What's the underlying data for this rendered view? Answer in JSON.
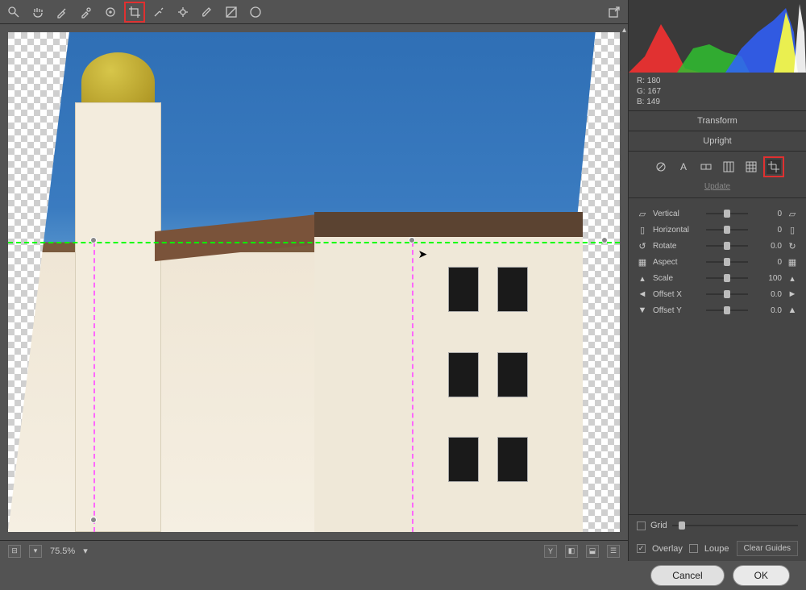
{
  "toolbar": {
    "tools": [
      "zoom",
      "hand",
      "eyedropper",
      "sampler",
      "target",
      "crop",
      "spot",
      "adjust",
      "brush",
      "gradient",
      "radial"
    ],
    "selected_index": 5
  },
  "canvas": {
    "zoom_label": "75.5%"
  },
  "rgb": {
    "R_label": "R:",
    "R": "180",
    "G_label": "G:",
    "G": "167",
    "B_label": "B:",
    "B": "149"
  },
  "panel": {
    "transform_title": "Transform",
    "upright_title": "Upright",
    "upright_modes": [
      "off",
      "auto",
      "level",
      "vertical",
      "full",
      "guided"
    ],
    "upright_selected": 5,
    "update_label": "Update"
  },
  "sliders": {
    "items": [
      {
        "label": "Vertical",
        "value": "0",
        "icon_left": "v-top",
        "icon_right": "v-bottom"
      },
      {
        "label": "Horizontal",
        "value": "0",
        "icon_left": "h-left",
        "icon_right": "h-right"
      },
      {
        "label": "Rotate",
        "value": "0.0",
        "icon_left": "rot-ccw",
        "icon_right": "rot-cw"
      },
      {
        "label": "Aspect",
        "value": "0",
        "icon_left": "grid9",
        "icon_right": "grid9"
      },
      {
        "label": "Scale",
        "value": "100",
        "icon_left": "lock",
        "icon_right": "lock"
      },
      {
        "label": "Offset X",
        "value": "0.0",
        "icon_left": "arrow-l",
        "icon_right": "arrow-r"
      },
      {
        "label": "Offset Y",
        "value": "0.0",
        "icon_left": "arrow-d",
        "icon_right": "arrow-u"
      }
    ]
  },
  "grid": {
    "label": "Grid",
    "checked": false
  },
  "opts": {
    "overlay_label": "Overlay",
    "overlay_checked": true,
    "loupe_label": "Loupe",
    "loupe_checked": false,
    "clear_label": "Clear Guides"
  },
  "footer": {
    "cancel": "Cancel",
    "ok": "OK"
  },
  "status_icons": {
    "Y": "Y"
  }
}
